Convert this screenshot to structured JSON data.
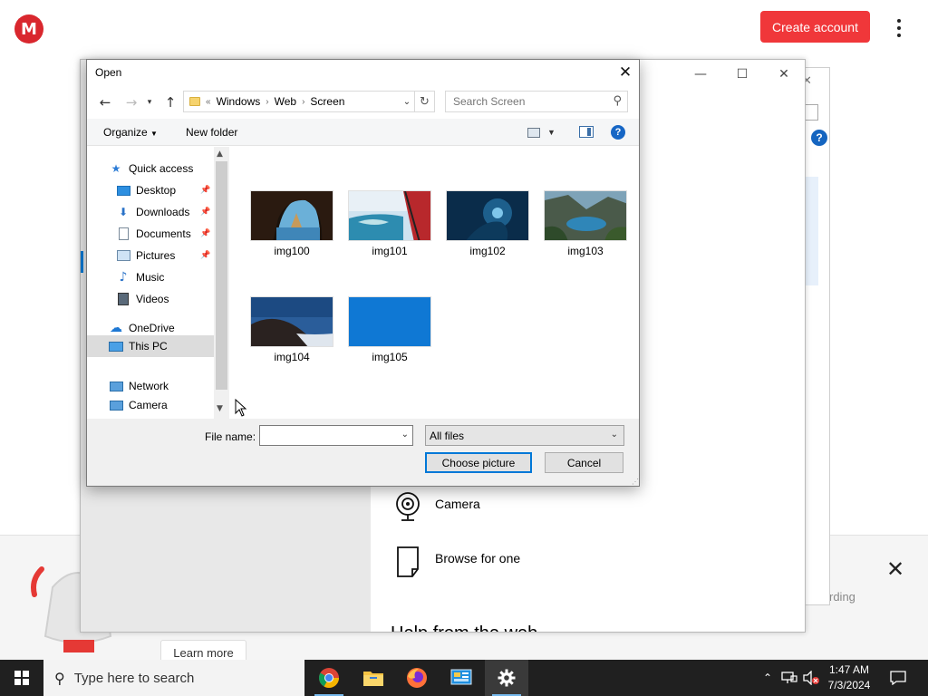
{
  "mega": {
    "logo_letter": "M",
    "create_account": "Create account",
    "learn_more": "Learn more",
    "recording_text": "rding",
    "brand_color": "#d9272e"
  },
  "settings_window": {
    "options": [
      {
        "label": "Camera",
        "icon": "camera-icon"
      },
      {
        "label": "Browse for one",
        "icon": "file-icon"
      }
    ],
    "cut_heading": "Help from the web"
  },
  "dialog": {
    "title": "Open",
    "address": {
      "overflow": "«",
      "crumbs": [
        "Windows",
        "Web",
        "Screen"
      ]
    },
    "search_placeholder": "Search Screen",
    "toolbar": {
      "organize": "Organize",
      "new_folder": "New folder",
      "help": "?"
    },
    "nav_items": [
      {
        "label": "Quick access",
        "icon": "star-icon",
        "pinned": false
      },
      {
        "label": "Desktop",
        "icon": "desktop-icon",
        "pinned": true
      },
      {
        "label": "Downloads",
        "icon": "download-icon",
        "pinned": true
      },
      {
        "label": "Documents",
        "icon": "documents-icon",
        "pinned": true
      },
      {
        "label": "Pictures",
        "icon": "pictures-icon",
        "pinned": true
      },
      {
        "label": "Music",
        "icon": "music-icon",
        "pinned": false
      },
      {
        "label": "Videos",
        "icon": "videos-icon",
        "pinned": false
      },
      {
        "label": "OneDrive",
        "icon": "cloud-icon",
        "pinned": false
      },
      {
        "label": "This PC",
        "icon": "computer-icon",
        "pinned": false,
        "selected": true
      },
      {
        "label": "Network",
        "icon": "network-icon",
        "pinned": false
      },
      {
        "label": "Camera",
        "icon": "camera-icon",
        "pinned": false
      }
    ],
    "files": [
      {
        "name": "img100"
      },
      {
        "name": "img101"
      },
      {
        "name": "img102"
      },
      {
        "name": "img103"
      },
      {
        "name": "img104"
      },
      {
        "name": "img105"
      }
    ],
    "file_name_label": "File name:",
    "file_name_value": "",
    "file_type": "All files",
    "choose_button": "Choose picture",
    "cancel_button": "Cancel"
  },
  "taskbar": {
    "search_placeholder": "Type here to search",
    "apps": [
      "chrome-icon",
      "file-explorer-icon",
      "firefox-icon",
      "control-panel-icon",
      "settings-icon"
    ],
    "time": "1:47 AM",
    "date": "7/3/2024"
  }
}
